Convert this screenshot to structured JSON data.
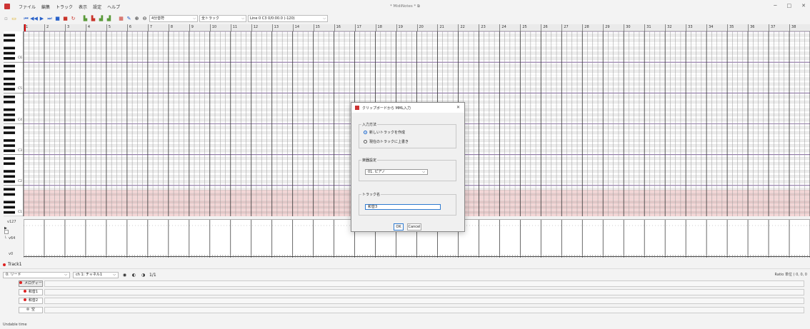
{
  "window": {
    "title": "* MidiNotes * ⧉",
    "minimize": "─",
    "maximize": "□",
    "close": "✕"
  },
  "menu": [
    "ファイル",
    "編集",
    "トラック",
    "表示",
    "設定",
    "ヘルプ"
  ],
  "toolbar": {
    "note_length": "4分音符",
    "track_mode": "全トラック",
    "position": "Line 0 C3 0/0:00.0 (-120)"
  },
  "ruler": {
    "measures": [
      "1",
      "2",
      "3",
      "4",
      "5",
      "6",
      "7",
      "8",
      "9",
      "10",
      "11",
      "12",
      "13",
      "14",
      "15",
      "16",
      "17",
      "18",
      "19",
      "20",
      "21",
      "22",
      "23",
      "24",
      "25",
      "26",
      "27",
      "28",
      "29",
      "30",
      "31",
      "32",
      "33",
      "34",
      "35",
      "36",
      "37",
      "38"
    ]
  },
  "piano": {
    "octaves": [
      "C6",
      "C5",
      "C4",
      "C3",
      "C2",
      "C1"
    ]
  },
  "velocity": {
    "top_label": "v127",
    "mid_label": "v64",
    "bottom_label": "v0"
  },
  "track_header": {
    "name": "Track1"
  },
  "track_tools": {
    "tool_select": "0: リード",
    "channel_select": "ch 1: チャネル1",
    "page": "1/1",
    "right_info": "Ratio 単位 ( 0, 0, 0"
  },
  "tracks": [
    {
      "label": "メロディー"
    },
    {
      "label": "和音1"
    },
    {
      "label": "和音2"
    },
    {
      "label": "空"
    }
  ],
  "status": "Undable time",
  "dialog": {
    "title": "クリップボードから MML入力",
    "close": "✕",
    "input_method_label": "入力方法",
    "option_new_track": "新しいトラックを作成",
    "option_overwrite": "現在のトラックに上書き",
    "instrument_label": "楽器設定",
    "instrument_value": "01. ピアノ",
    "track_name_label": "トラック名",
    "track_name_value": "和音3",
    "ok": "OK",
    "cancel": "Cancel"
  },
  "colors": {
    "accent": "#1a64c8",
    "low_range": "#f4d6d6",
    "record": "#dd2222"
  }
}
